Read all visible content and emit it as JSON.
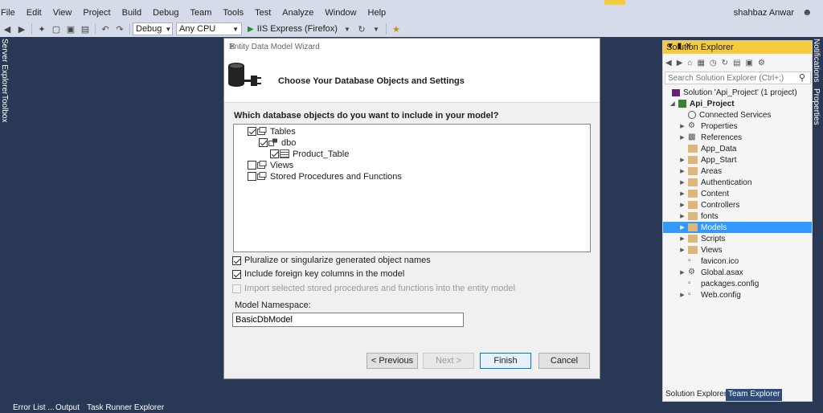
{
  "menu": [
    "File",
    "Edit",
    "View",
    "Project",
    "Build",
    "Debug",
    "Team",
    "Tools",
    "Test",
    "Analyze",
    "Window",
    "Help"
  ],
  "user": {
    "name": "shahbaz Anwar"
  },
  "toolbar": {
    "config": "Debug",
    "platform": "Any CPU",
    "run_label": "IIS Express (Firefox)"
  },
  "side_tabs": {
    "left": [
      "Server Explorer",
      "Toolbox"
    ],
    "right": [
      "Notifications",
      "Properties"
    ]
  },
  "status_bar": [
    "Error List ...",
    "Output",
    "Task Runner Explorer"
  ],
  "dialog": {
    "title": "Entity Data Model Wizard",
    "header": "Choose Your Database Objects and Settings",
    "question": "Which database objects do you want to include in your model?",
    "tree": [
      {
        "label": "Tables",
        "checked": true
      },
      {
        "label": "dbo",
        "checked": true
      },
      {
        "label": "Product_Table",
        "checked": true
      },
      {
        "label": "Views",
        "checked": false
      },
      {
        "label": "Stored Procedures and Functions",
        "checked": false
      }
    ],
    "options": [
      {
        "label": "Pluralize or singularize generated object names",
        "checked": true
      },
      {
        "label": "Include foreign key columns in the model",
        "checked": true
      },
      {
        "label": "Import selected stored procedures and functions into the entity model",
        "checked": false
      }
    ],
    "namespace_label": "Model Namespace:",
    "namespace_value": "BasicDbModel",
    "buttons": {
      "previous": "< Previous",
      "next": "Next >",
      "finish": "Finish",
      "cancel": "Cancel"
    }
  },
  "solution_explorer": {
    "title": "Solution Explorer",
    "search_placeholder": "Search Solution Explorer (Ctrl+;)",
    "solution": "Solution 'Api_Project' (1 project)",
    "project": "Api_Project",
    "items": [
      "Connected Services",
      "Properties",
      "References",
      "App_Data",
      "App_Start",
      "Areas",
      "Authentication",
      "Content",
      "Controllers",
      "fonts",
      "Models",
      "Scripts",
      "Views",
      "favicon.ico",
      "Global.asax",
      "packages.config",
      "Web.config"
    ],
    "selected": "Models",
    "tabs": [
      "Solution Explorer",
      "Team Explorer"
    ]
  }
}
